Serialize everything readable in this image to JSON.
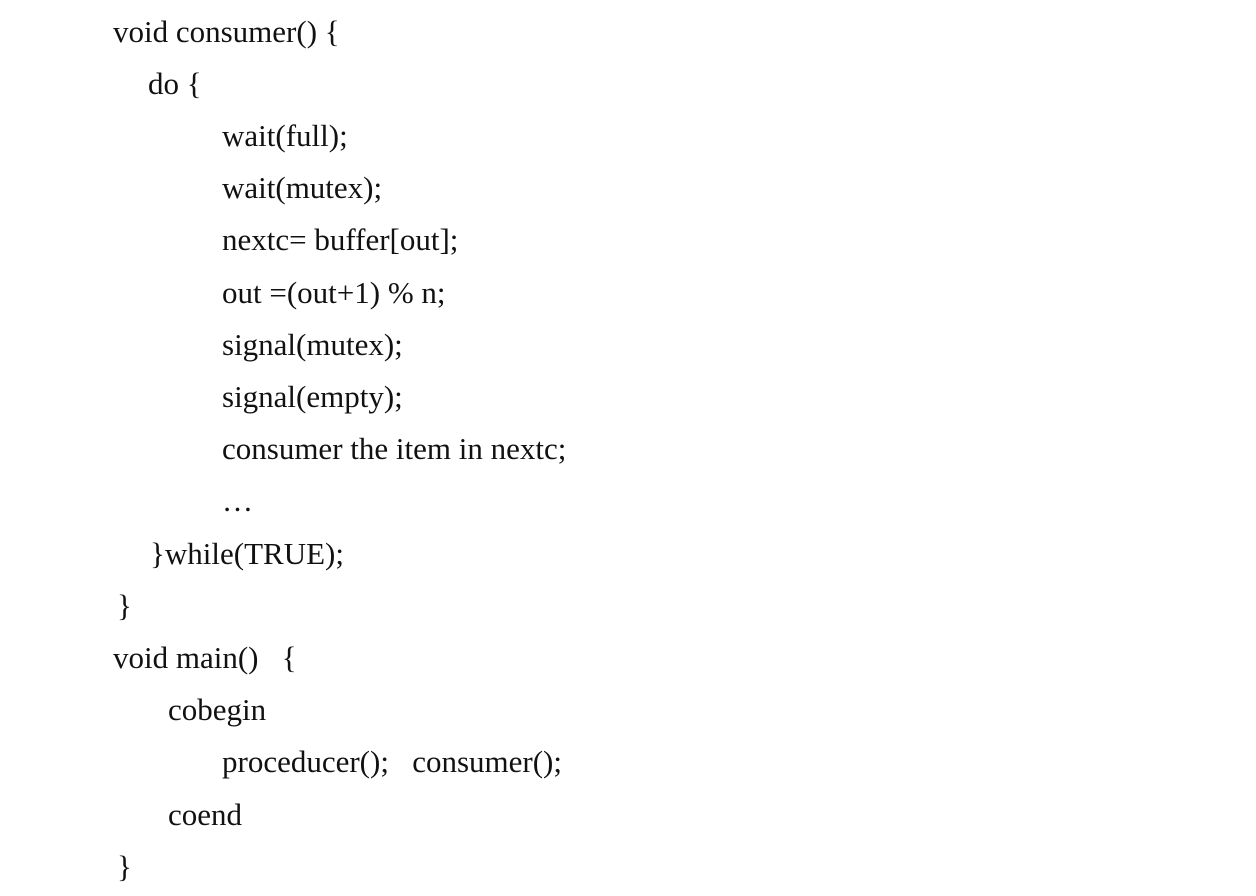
{
  "code": {
    "lines": [
      "void consumer() {",
      "do {",
      "wait(full);",
      "wait(mutex);",
      "nextc= buffer[out];",
      "out =(out+1) % n;",
      "signal(mutex);",
      "signal(empty);",
      "consumer the item in nextc;",
      "…",
      "}while(TRUE);",
      "}",
      "void main()   {",
      "cobegin",
      "proceducer();   consumer();",
      "coend",
      "}"
    ]
  }
}
